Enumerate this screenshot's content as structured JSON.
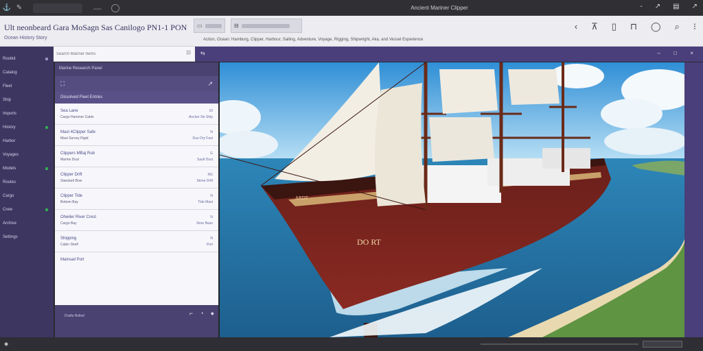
{
  "titlebar": {
    "title": "Ancient Mariner Clipper",
    "icons": [
      "app-logo-icon",
      "edit-icon"
    ],
    "right_icons": [
      "-",
      "↗",
      "▤",
      "↗"
    ]
  },
  "header": {
    "title": "Ult neonbeard Gara MoSagn Sas Canilogo PN1-1 PON",
    "subtitle": "Ocean History Story",
    "caption": "Action, Ocean: Hamburg, Clipper, Harbour, Sailing, Adventure, Voyage, Rigging, Shipwright, Aka, and Vessel Experience",
    "ctrl_a": "▭",
    "ctrl_b": "⊟",
    "icons": [
      "‹",
      "⊼",
      "▯",
      "⊓",
      "◯",
      "⌕",
      "⁝"
    ]
  },
  "sidebar": {
    "items": [
      {
        "label": "Rootkit",
        "dot": ""
      },
      {
        "label": "Catalog",
        "dot": ""
      },
      {
        "label": "Fleet",
        "dot": ""
      },
      {
        "label": "Ship",
        "dot": ""
      },
      {
        "label": "Imports",
        "dot": ""
      },
      {
        "label": "History",
        "dot": "#33aa55"
      },
      {
        "label": "Harbor",
        "dot": ""
      },
      {
        "label": "Voyages",
        "dot": ""
      },
      {
        "label": "Models",
        "dot": "#33aa55"
      },
      {
        "label": "Routes",
        "dot": ""
      },
      {
        "label": "Cargo",
        "dot": ""
      },
      {
        "label": "Crew",
        "dot": "#33aa55"
      },
      {
        "label": "Archive",
        "dot": ""
      },
      {
        "label": "Settings",
        "dot": ""
      }
    ]
  },
  "search": {
    "placeholder": "Search Mariner Items",
    "clear": "⊡"
  },
  "purple_bar": {
    "left_icon": "⇆",
    "right_icons": [
      "–",
      "□",
      "×"
    ]
  },
  "panel": {
    "header": "Marine Research Panel",
    "tool_left": "⛶",
    "tool_right": "↗",
    "list_title": "Dissolved Fleet Entries",
    "rows": [
      {
        "name": "Sea Lane",
        "meta": "Cargo Hammer Cabin",
        "value": "Anchor No Ship",
        "flag": "10"
      },
      {
        "name": "Mast 4Clipper Safe",
        "meta": "Mast Survey Rigid",
        "value": "Due Dry Fast",
        "flag": "N"
      },
      {
        "name": "Clippers MBaj Rub",
        "meta": "Marine Dust",
        "value": "Sault Dust",
        "flag": "G"
      },
      {
        "name": "Clipper Drift",
        "meta": "Standard Bow",
        "value": "Stone Drift",
        "flag": "NG"
      },
      {
        "name": "Clipper Tide",
        "meta": "Bottom Bay",
        "value": "Tide Mast",
        "flag": "N"
      },
      {
        "name": "Ohwiler River Crest",
        "meta": "Cargo Bay",
        "value": "Nore Base",
        "flag": "N"
      },
      {
        "name": "Shipping",
        "meta": "Cabin Shelf",
        "value": "Port",
        "flag": "N"
      },
      {
        "name": "Mainsail Port",
        "meta": "",
        "value": "",
        "flag": ""
      }
    ],
    "footer_label": "Drafts Rolled",
    "footer_icons": [
      "⌐",
      "◔",
      "●"
    ]
  },
  "canvas": {
    "hull_text": "DO RT",
    "bow_text": "ARDT"
  },
  "statusbar": {
    "left": "◆"
  }
}
